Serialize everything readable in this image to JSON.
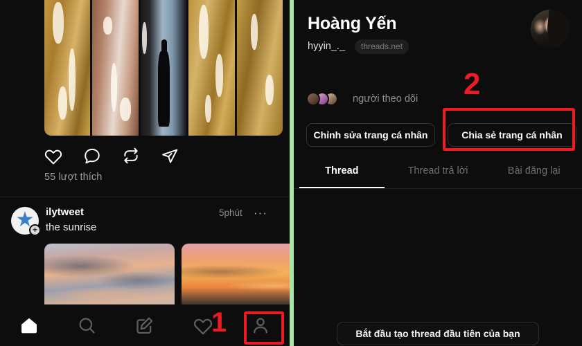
{
  "colors": {
    "background": "#0d0d0d",
    "divider_green": "#a9e3a9",
    "annotation_red": "#ed1c24",
    "accent_white": "#ffffff",
    "muted_text": "#8f8f8f"
  },
  "left_panel": {
    "post_top": {
      "image_name": "wooden-planks-silhouette-photo",
      "actions": [
        {
          "name": "like-icon",
          "label": "Thích"
        },
        {
          "name": "comment-icon",
          "label": "Bình luận"
        },
        {
          "name": "repost-icon",
          "label": "Đăng lại"
        },
        {
          "name": "share-icon",
          "label": "Chia sẻ"
        }
      ],
      "likes_text": "55 lượt thích"
    },
    "post_second": {
      "avatar_icon": "star-avatar-icon",
      "follow_badge": "+",
      "username": "ilytweet",
      "caption": "the sunrise",
      "timestamp": "5phút",
      "more_label": "···",
      "thumbs": [
        {
          "name": "sunrise-thumb-1"
        },
        {
          "name": "sunrise-thumb-2"
        }
      ]
    },
    "navbar": {
      "items": [
        {
          "name": "nav-home",
          "icon": "home-icon",
          "label": "Trang chủ",
          "active": true
        },
        {
          "name": "nav-search",
          "icon": "search-icon",
          "label": "Tìm kiếm",
          "active": false
        },
        {
          "name": "nav-compose",
          "icon": "compose-icon",
          "label": "Soạn thảo",
          "active": false
        },
        {
          "name": "nav-activity",
          "icon": "heart-icon",
          "label": "Hoạt động",
          "active": false
        },
        {
          "name": "nav-profile",
          "icon": "person-icon",
          "label": "Trang cá nhân",
          "active": false
        }
      ]
    },
    "annotation": {
      "step_number": "1"
    }
  },
  "right_panel": {
    "profile": {
      "display_name": "Hoàng Yến",
      "handle": "hyyin_._",
      "domain_badge": "threads.net",
      "avatar_icon": "profile-avatar"
    },
    "followers": {
      "label": "người theo dõi",
      "avatar_count": 3
    },
    "buttons": {
      "edit_profile": "Chỉnh sửa trang cá nhân",
      "share_profile": "Chia sẻ trang cá nhân"
    },
    "tabs": [
      {
        "label": "Thread",
        "active": true
      },
      {
        "label": "Thread trả lời",
        "active": false
      },
      {
        "label": "Bài đăng lại",
        "active": false
      }
    ],
    "start_button": "Bắt đầu tạo thread đầu tiên của bạn",
    "annotation": {
      "step_number": "2"
    }
  }
}
